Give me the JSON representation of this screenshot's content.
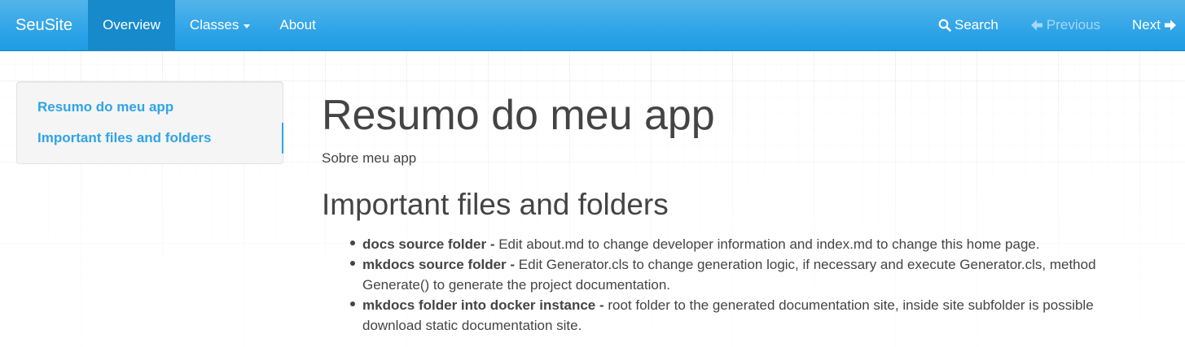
{
  "navbar": {
    "brand": "SeuSite",
    "items": [
      {
        "label": "Overview",
        "active": true
      },
      {
        "label": "Classes",
        "has_dropdown": true
      },
      {
        "label": "About"
      }
    ],
    "search_label": "Search",
    "previous_label": "Previous",
    "next_label": "Next",
    "colors": {
      "bar": "#2fa4e7",
      "active": "#178acc"
    }
  },
  "toc": {
    "items": [
      {
        "label": "Resumo do meu app"
      },
      {
        "label": "Important files and folders",
        "active": true
      }
    ],
    "link_color": "#2fa4e7"
  },
  "content": {
    "title": "Resumo do meu app",
    "subtitle": "Sobre meu app",
    "section_title": "Important files and folders",
    "list": [
      {
        "term": "docs source folder",
        "sep": " - ",
        "text": "Edit about.md to change developer information and index.md to change this home page."
      },
      {
        "term": "mkdocs source folder",
        "sep": " - ",
        "text": "Edit Generator.cls to change generation logic, if necessary and execute Generator.cls, method Generate() to generate the project documentation."
      },
      {
        "term": "mkdocs folder into docker instance",
        "sep": " - ",
        "text": "root folder to the generated documentation site, inside site subfolder is possible download static documentation site."
      }
    ]
  }
}
